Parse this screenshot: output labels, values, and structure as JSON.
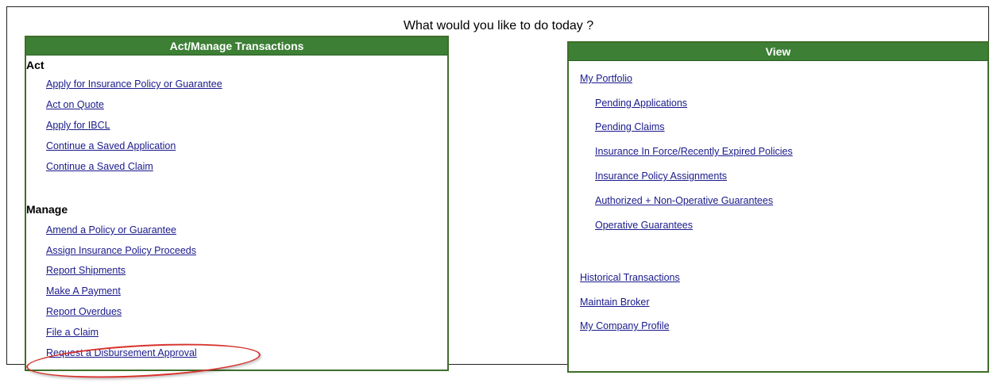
{
  "heading": "What would you like to do today ?",
  "act_manage_panel": {
    "header": "Act/Manage Transactions",
    "act": {
      "title": "Act",
      "links": [
        "Apply for Insurance Policy or Guarantee",
        "Act on Quote",
        "Apply for IBCL",
        "Continue a Saved Application",
        "Continue a Saved Claim"
      ]
    },
    "manage": {
      "title": "Manage",
      "links": [
        "Amend a Policy or Guarantee",
        "Assign Insurance Policy Proceeds",
        "Report Shipments",
        "Make A Payment",
        "Report Overdues",
        "File a Claim",
        "Request a Disbursement Approval"
      ]
    }
  },
  "view_panel": {
    "header": "View",
    "my_portfolio": "My Portfolio",
    "portfolio_links": [
      "Pending Applications",
      "Pending Claims",
      "Insurance In Force/Recently Expired Policies",
      "Insurance Policy Assignments",
      "Authorized + Non-Operative Guarantees",
      "Operative Guarantees"
    ],
    "other_links": [
      "Historical Transactions",
      "Maintain Broker",
      "My Company Profile"
    ]
  },
  "colors": {
    "panel_header_bg": "#3c7f35",
    "panel_border": "#3f6e2a",
    "link": "#1a1a8c",
    "highlight_oval": "#d8322c"
  }
}
